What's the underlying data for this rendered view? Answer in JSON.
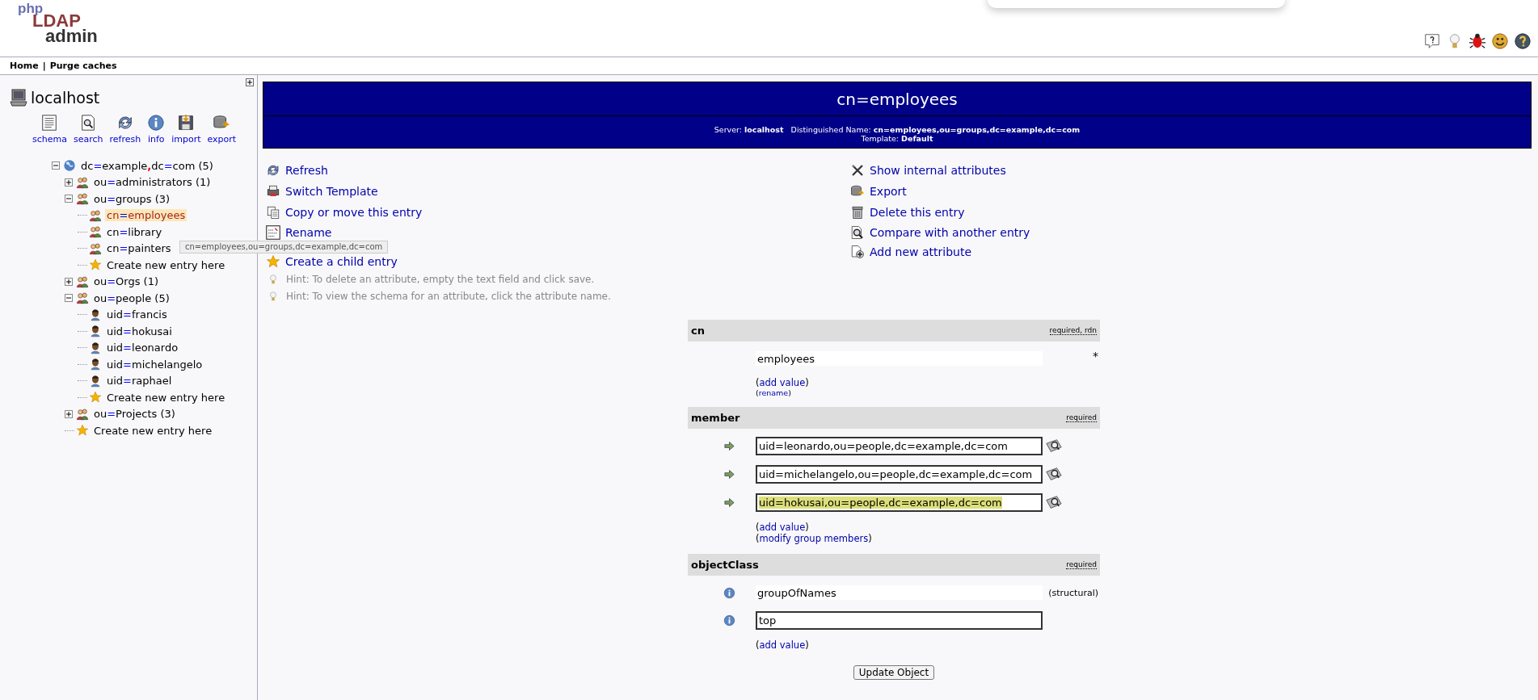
{
  "logo": {
    "top": "php",
    "middle": "LDAP",
    "bottom": "admin"
  },
  "nav": {
    "links": [
      "Home",
      "Purge caches"
    ],
    "separator": "|"
  },
  "server": {
    "name": "localhost",
    "tools": [
      "schema",
      "search",
      "refresh",
      "info",
      "import",
      "export"
    ]
  },
  "tree": [
    {
      "kind": "domain",
      "label": "dc=example,dc=com (5)",
      "expanded": true,
      "selected": false,
      "children": [
        {
          "kind": "ou",
          "label": "ou=administrators (1)",
          "expanded": false,
          "selected": false
        },
        {
          "kind": "ou",
          "label": "ou=groups (3)",
          "expanded": true,
          "selected": false,
          "children": [
            {
              "kind": "group",
              "label": "cn=employees",
              "selected": true
            },
            {
              "kind": "group",
              "label": "cn=library",
              "selected": false
            },
            {
              "kind": "group",
              "label": "cn=painters",
              "selected": false
            },
            {
              "kind": "create",
              "label": "Create new entry here",
              "selected": false
            }
          ]
        },
        {
          "kind": "ou",
          "label": "ou=Orgs (1)",
          "expanded": false,
          "selected": false
        },
        {
          "kind": "ou",
          "label": "ou=people (5)",
          "expanded": true,
          "selected": false,
          "children": [
            {
              "kind": "person",
              "label": "uid=francis",
              "selected": false
            },
            {
              "kind": "person",
              "label": "uid=hokusai",
              "selected": false
            },
            {
              "kind": "person",
              "label": "uid=leonardo",
              "selected": false
            },
            {
              "kind": "person",
              "label": "uid=michelangelo",
              "selected": false
            },
            {
              "kind": "person",
              "label": "uid=raphael",
              "selected": false
            },
            {
              "kind": "create",
              "label": "Create new entry here",
              "selected": false
            }
          ]
        },
        {
          "kind": "ou",
          "label": "ou=Projects (3)",
          "expanded": false,
          "selected": false
        },
        {
          "kind": "create",
          "label": "Create new entry here",
          "selected": false
        }
      ]
    }
  ],
  "tooltip": "cn=employees,ou=groups,dc=example,dc=com",
  "entry": {
    "title": "cn=employees",
    "info": "Server: **localhost**   Distinguished Name: **cn=employees,ou=groups,dc=example,dc=com**",
    "template": "Template: **Default**"
  },
  "actions_left": [
    "Refresh",
    "Switch Template",
    "Copy or move this entry",
    "Rename",
    "Create a child entry"
  ],
  "actions_right": [
    "Show internal attributes",
    "Export",
    "Delete this entry",
    "Compare with another entry",
    "Add new attribute"
  ],
  "hints": [
    "Hint: To delete an attribute, empty the text field and click save.",
    "Hint: To view the schema for an attribute, click the attribute name."
  ],
  "attributes": [
    {
      "name": "cn",
      "kind": "text",
      "flags": "required, rdn",
      "values": [
        {
          "kind": "readonly",
          "value": "employees",
          "note": "*",
          "highlighted": false
        }
      ],
      "links": [
        {
          "open": "(",
          "text": "add value",
          "close": ")",
          "small": false
        },
        {
          "open": "(",
          "text": "rename",
          "close": ")",
          "small": true
        }
      ]
    },
    {
      "name": "member",
      "kind": "dn",
      "flags": "required",
      "values": [
        {
          "kind": "input",
          "value": "uid=leonardo,ou=people,dc=example,dc=com",
          "lookup": true,
          "highlighted": false
        },
        {
          "kind": "input",
          "value": "uid=michelangelo,ou=people,dc=example,dc=com",
          "lookup": true,
          "highlighted": false
        },
        {
          "kind": "input",
          "value": "uid=hokusai,ou=people,dc=example,dc=com",
          "lookup": true,
          "highlighted": true
        }
      ],
      "links": [
        {
          "open": "(",
          "text": "add value",
          "close": ")",
          "small": false
        },
        {
          "open": "(",
          "text": "modify group members",
          "close": ")",
          "small": false
        }
      ]
    },
    {
      "name": "objectClass",
      "kind": "objectclass",
      "flags": "required",
      "values": [
        {
          "kind": "readonly",
          "value": "groupOfNames",
          "note": "(structural)",
          "highlighted": false
        },
        {
          "kind": "input",
          "value": "top",
          "highlighted": false
        }
      ],
      "links": [
        {
          "open": "(",
          "text": "add value",
          "close": ")",
          "small": false
        }
      ]
    }
  ],
  "submit": "Update Object"
}
